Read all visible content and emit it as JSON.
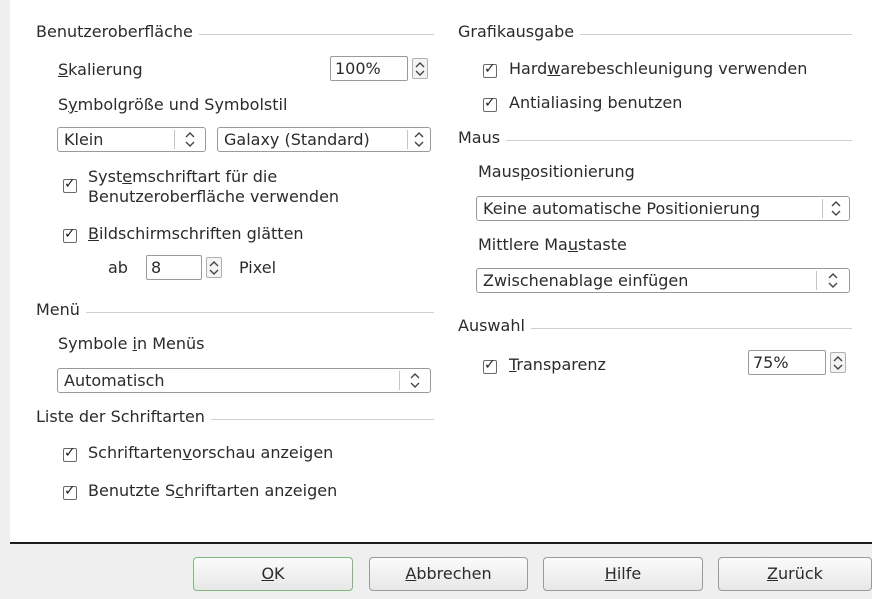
{
  "benutzeroberflaeche": {
    "title": "Benutzeroberfläche",
    "skalierung_label_first": "S",
    "skalierung_label_rest": "kalierung",
    "skalierung_value": "100%",
    "symbol_label_first": "S",
    "symbol_label_u": "y",
    "symbol_label_rest": "mbolgröße und Symbolstil",
    "size_value": "Klein",
    "style_value": "Galaxy (Standard)",
    "systemfont_line1_a": "Syst",
    "systemfont_line1_u": "e",
    "systemfont_line1_b": "mschriftart für die",
    "systemfont_line2": "Benutzeroberfläche verwenden",
    "smoothing_u": "B",
    "smoothing_rest": "ildschirmschriften glätten",
    "ab_label": "ab",
    "ab_value": "8",
    "pixel_label": "Pixel"
  },
  "menu": {
    "title": "Menü",
    "symbols_a": "Symbole ",
    "symbols_u": "i",
    "symbols_b": "n Menüs",
    "symbols_value": "Automatisch"
  },
  "fontlist": {
    "title": "Liste der Schriftarten",
    "preview_a": "Schriftarten",
    "preview_u": "v",
    "preview_b": "orschau anzeigen",
    "used_a": "Benutzte S",
    "used_u": "c",
    "used_b": "hriftarten anzeigen"
  },
  "grafik": {
    "title": "Grafikausgabe",
    "hw_a": "Hard",
    "hw_u": "w",
    "hw_b": "arebeschleunigung verwenden",
    "aa_a": "Antialiasin",
    "aa_u": "g",
    "aa_b": " benutzen"
  },
  "maus": {
    "title": "Maus",
    "pos_a": "Maus",
    "pos_u": "p",
    "pos_b": "ositionierung",
    "pos_value": "Keine automatische Positionierung",
    "mid_a": "Mittlere Ma",
    "mid_u": "u",
    "mid_b": "staste",
    "mid_value": "Zwischenablage einfügen"
  },
  "auswahl": {
    "title": "Auswahl",
    "trans_u": "T",
    "trans_rest": "ransparenz",
    "trans_value": "75%"
  },
  "buttons": {
    "ok_u": "O",
    "ok_rest": "K",
    "cancel_u": "A",
    "cancel_rest": "bbrechen",
    "help_u": "H",
    "help_rest": "ilfe",
    "back_u": "Z",
    "back_rest": "urück"
  }
}
